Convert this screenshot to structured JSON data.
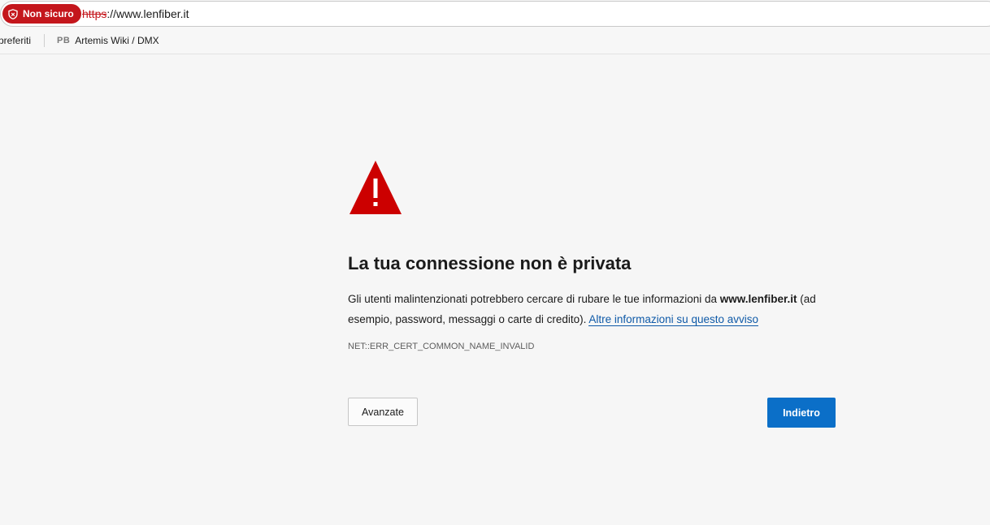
{
  "browser": {
    "security_label": "Non sicuro",
    "url_scheme": "https",
    "url_rest": "://www.lenfiber.it"
  },
  "favorites": {
    "first_label": "preferiti",
    "items": [
      {
        "icon_text": "PB",
        "label": "Artemis Wiki / DMX"
      }
    ]
  },
  "page": {
    "warning_icon": "warning-triangle-icon",
    "title": "La tua connessione non è privata",
    "desc_before": "Gli utenti malintenzionati potrebbero cercare di rubare le tue informazioni da ",
    "desc_domain": "www.lenfiber.it",
    "desc_after": " (ad esempio, password, messaggi o carte di credito). ",
    "desc_link": "Altre informazioni su questo avviso",
    "error_code": "NET::ERR_CERT_COMMON_NAME_INVALID",
    "advanced_label": "Avanzate",
    "back_label": "Indietro"
  },
  "colors": {
    "danger": "#c4161c",
    "primary": "#0b6fc8",
    "link": "#0f5aa8",
    "background": "#f6f6f6"
  }
}
